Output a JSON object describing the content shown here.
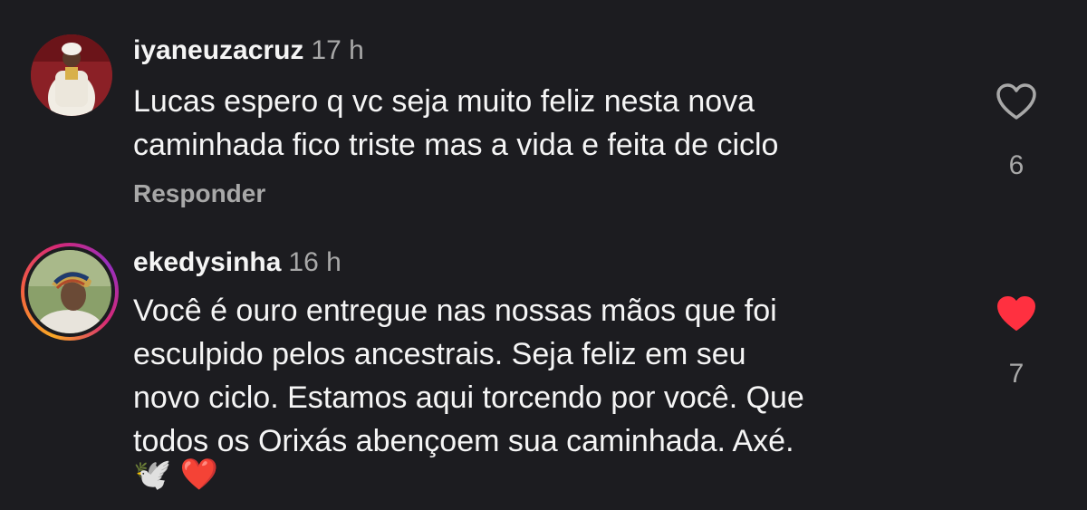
{
  "comments": [
    {
      "username": "iyaneuzacruz",
      "time": "17 h",
      "text": "Lucas espero q vc seja muito feliz nesta nova\ncaminhada  fico triste  mas a vida e feita de ciclo",
      "reply_label": "Responder",
      "likes": "6",
      "liked": false,
      "avatar_icon": "user-avatar-photo"
    },
    {
      "username": "ekedysinha",
      "time": "16 h",
      "text": "Você é ouro entregue nas nossas mãos que foi\nesculpido pelos ancestrais. Seja feliz em seu\nnovo ciclo. Estamos aqui torcendo por você. Que\ntodos os Orixás abençoem sua caminhada. Axé.",
      "emojis": "🕊️ ❤️",
      "likes": "7",
      "liked": true,
      "avatar_icon": "story-ring-avatar-photo"
    }
  ],
  "colors": {
    "background": "#1c1c20",
    "text": "#f5f5f5",
    "secondary": "#a8a8a8",
    "like_red": "#ff3040",
    "story_ring_start": "#f9a825",
    "story_ring_end": "#d62976"
  }
}
